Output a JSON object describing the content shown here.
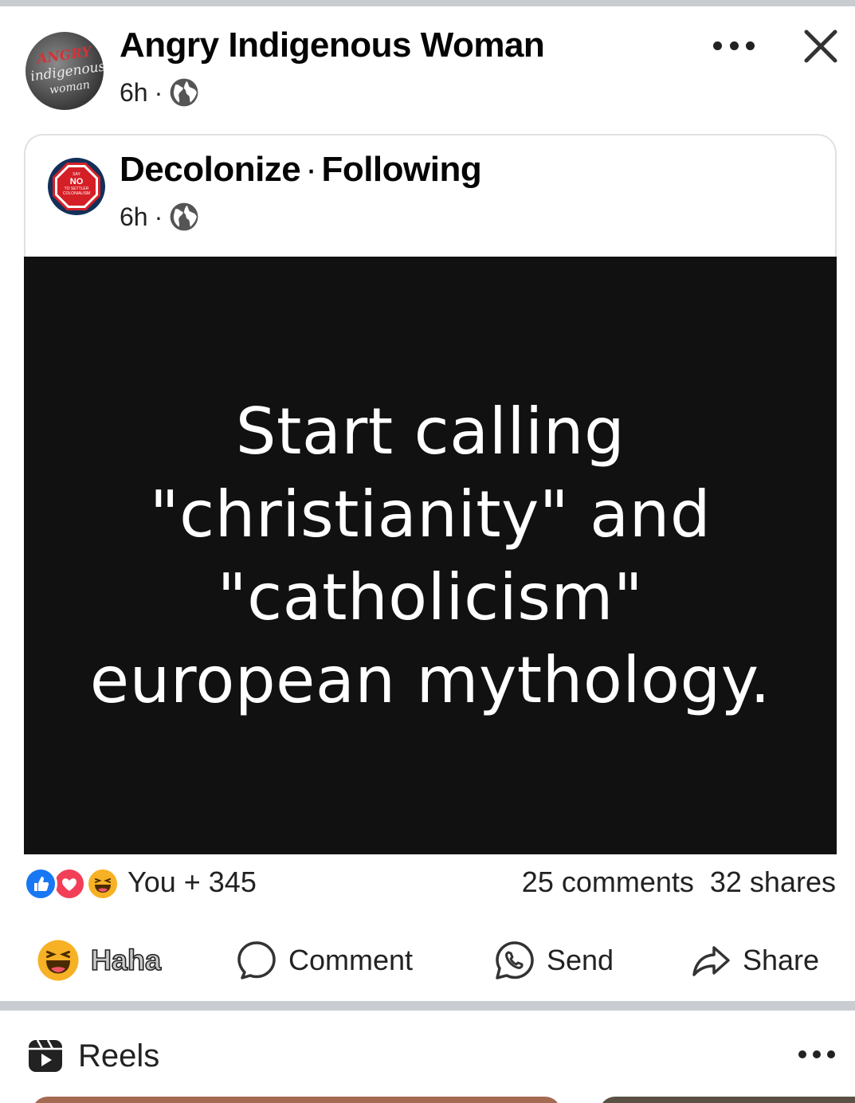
{
  "post": {
    "author": "Angry Indigenous Woman",
    "time": "6h",
    "dot": "·",
    "avatar_text": [
      "ANGRY",
      "indigenous",
      "woman"
    ]
  },
  "shared": {
    "page": "Decolonize",
    "separator": "·",
    "follow_status": "Following",
    "time": "6h",
    "dot": "·",
    "avatar_text": [
      "SAY",
      "NO",
      "TO SETTLER",
      "COLONIALISM"
    ]
  },
  "image_quote": {
    "lines": [
      "Start calling",
      "\"christianity\" and",
      "\"catholicism\"",
      "european mythology."
    ]
  },
  "engagement": {
    "reactors": "You + 345",
    "comments": "25 comments",
    "shares": "32 shares"
  },
  "actions": {
    "react": "Haha",
    "comment": "Comment",
    "send": "Send",
    "share": "Share"
  },
  "reels": {
    "label": "Reels"
  },
  "colors": {
    "like": "#1877f2",
    "love": "#f33e58",
    "haha": "#f7b125",
    "image_bg": "#111111",
    "divider": "#c9ccd1"
  }
}
